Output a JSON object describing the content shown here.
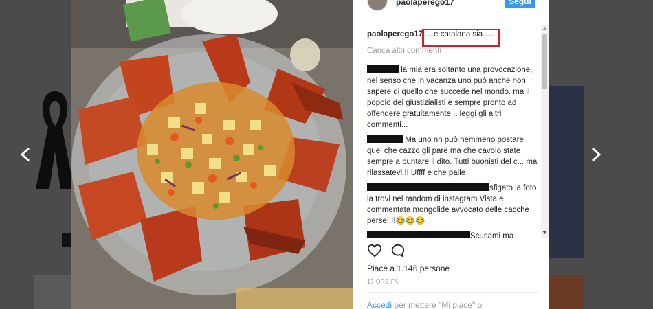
{
  "header": {
    "username": "paolaperego17",
    "follow_label": "Segui"
  },
  "caption": {
    "username": "paolaperego17",
    "text": " ... e catalana sia ...."
  },
  "load_more_label": "Carica altri commenti",
  "comments": [
    {
      "text": " la mia era soltanto una provocazione, nel senso che in vacanza uno può anche non sapere di quello che succede nel mondo. ma il popolo dei giustizialisti è sempre pronto ad offendere gratuitamente... leggi gli altri commenti..."
    },
    {
      "text": " Ma uno nn può nemmeno postare quel che cazzo gli pare ma che cavolo state sempre a puntare il dito. Tutti buonisti del c... ma rilassatevi !! Uffff e che palle"
    },
    {
      "text": "sfigato la foto la trovi nel random di instagram.Vista e commentata mongolide avvocato delle cacche perse!!!!😂😂😂"
    },
    {
      "text": "Scusami ma"
    }
  ],
  "likes_label": "Piace a 1.146 persone",
  "timestamp": "17 ORE FA",
  "login": {
    "link_label": "Accedi",
    "text": " per mettere \"Mi piace\" o"
  },
  "colors": {
    "accent": "#3897f0",
    "highlight": "#d81d2a",
    "overlay": "#4b4b4b"
  },
  "icons": [
    "chevron-left-icon",
    "chevron-right-icon",
    "heart-icon",
    "comment-bubble-icon"
  ]
}
